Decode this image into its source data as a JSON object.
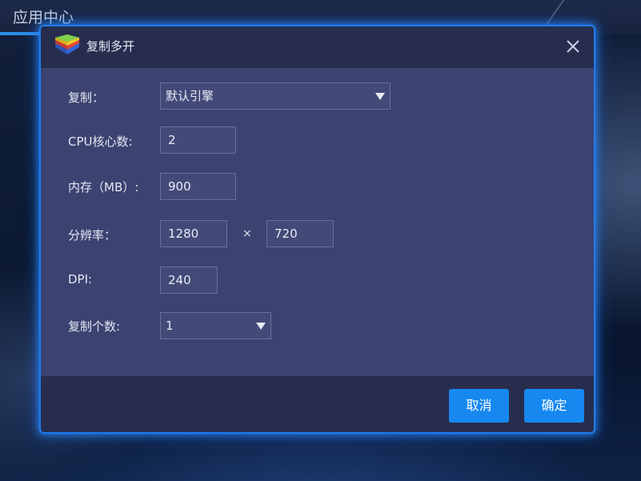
{
  "background": {
    "app_title": "应用中心"
  },
  "dialog": {
    "title": "复制多开",
    "logo": "bluestacks-logo-icon",
    "close_icon": "close-icon"
  },
  "form": {
    "copy_label": "复制：",
    "copy_value": "默认引擎",
    "cpu_label": "CPU核心数:",
    "cpu_value": "2",
    "memory_label": "内存（MB）:",
    "memory_value": "900",
    "resolution_label": "分辨率：",
    "resolution_width": "1280",
    "resolution_separator": "×",
    "resolution_height": "720",
    "dpi_label": "DPI:",
    "dpi_value": "240",
    "count_label": "复制个数:",
    "count_value": "1",
    "dropdown_icon": "caret-down-icon"
  },
  "footer": {
    "cancel_label": "取消",
    "confirm_label": "确定"
  },
  "colors": {
    "accent": "#1688f0",
    "dialog_body": "#3c4371",
    "dialog_header": "#272d4d",
    "glow": "#1f7cf2"
  }
}
